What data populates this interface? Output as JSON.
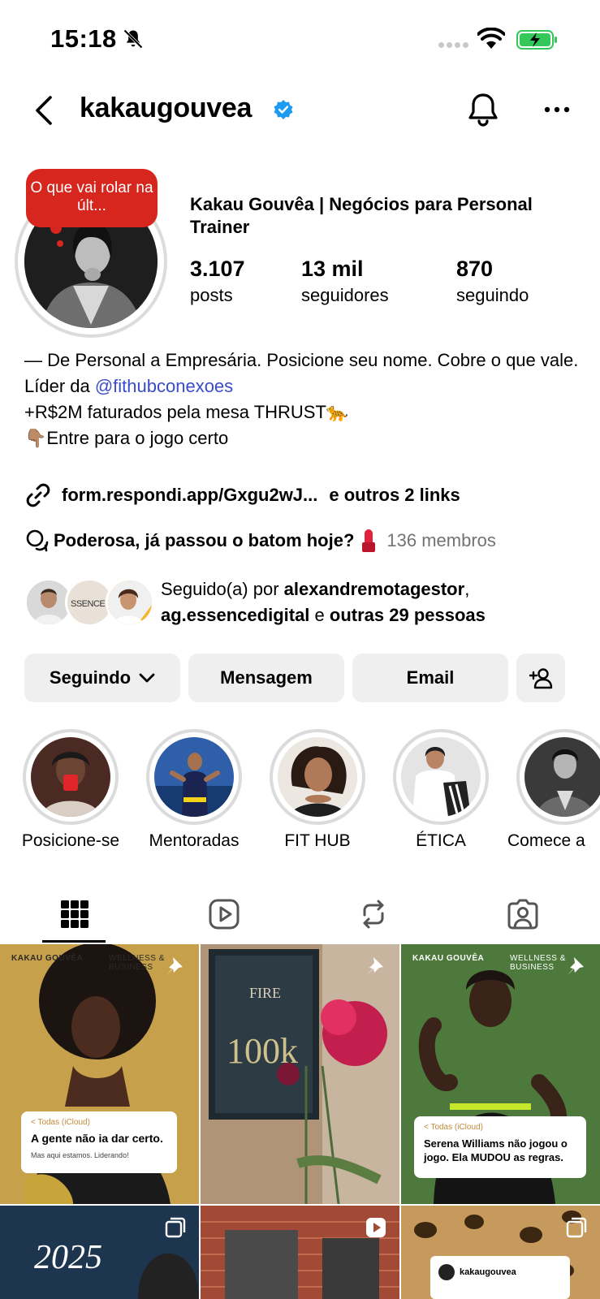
{
  "status_bar": {
    "time": "15:18"
  },
  "header": {
    "username": "kakaugouvea"
  },
  "profile": {
    "note": "O que vai rolar na últ...",
    "full_name": "Kakau Gouvêa | Negócios para Personal Trainer",
    "stats": [
      {
        "value": "3.107",
        "label": "posts"
      },
      {
        "value": "13 mil",
        "label": "seguidores"
      },
      {
        "value": "870",
        "label": "seguindo"
      }
    ],
    "bio": {
      "line1": "— De Personal a Empresária. Posicione seu nome. Cobre o que vale.",
      "line2_prefix": "Líder da ",
      "line2_mention": "@fithubconexoes",
      "line3": "+R$2M faturados pela mesa THRUST🐆",
      "line4": "👇🏽Entre para o jogo certo"
    },
    "link_text": "form.respondi.app/Gxgu2wJ...",
    "link_more": "e outros 2 links",
    "channel_name": "Poderosa, já passou o batom hoje?",
    "channel_members": "136 membros",
    "followed_by": {
      "prefix": "Seguido(a) por ",
      "user1": "alexandremotagestor",
      "sep": ",",
      "user2": "ag.essencedigital",
      "and": " e ",
      "others": "outras 29 pessoas"
    }
  },
  "buttons": {
    "following": "Seguindo",
    "message": "Mensagem",
    "email": "Email"
  },
  "highlights": [
    {
      "label": "Posicione-se"
    },
    {
      "label": "Mentoradas"
    },
    {
      "label": "FIT HUB"
    },
    {
      "label": "ÉTICA"
    },
    {
      "label": "Comece a"
    }
  ],
  "posts": {
    "p1": {
      "brand": "KAKAU GOUVÊA",
      "tag": "WELLNESS & BUSINESS",
      "card_top": "< Todas (iCloud)",
      "card_main": "A gente não ia dar certo.",
      "card_sub": "Mas aqui estamos. Liderando!"
    },
    "p2": {
      "title": "FIRE",
      "number": "100k"
    },
    "p3": {
      "brand": "KAKAU GOUVÊA",
      "tag": "WELLNESS & BUSINESS",
      "card_top": "< Todas (iCloud)",
      "card_main": "Serena Williams não jogou o jogo. Ela MUDOU as regras."
    },
    "p4": {
      "year": "2025"
    },
    "p6": {
      "handle": "kakaugouvea"
    }
  }
}
